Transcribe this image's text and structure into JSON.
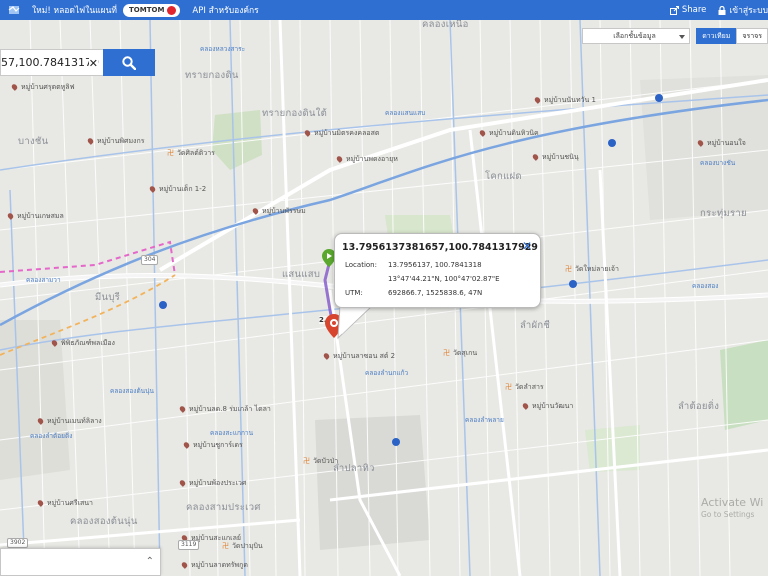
{
  "topbar": {
    "site_link": "ใหม่! หลอดไฟในแผนที่",
    "tomtom_badge": "TOMTOM",
    "api_link": "API สำหรับองค์กร",
    "share_label": "Share",
    "login_label": "เข้าสู่ระบบ"
  },
  "search": {
    "value": "57,100.78413179",
    "clear_symbol": "✕"
  },
  "layers": {
    "selected": "เลือกชั้นข้อมูล",
    "satellite_label": "ดาวเทียม",
    "traffic_label": "จราจร"
  },
  "popup": {
    "title": "13.7956137381657,100.7841317929",
    "close_symbol": "✕",
    "location_key": "Location:",
    "location_decimal": "13.7956137, 100.7841318",
    "location_dms": "13°47'44.21\"N, 100°47'02.87\"E",
    "utm_key": "UTM:",
    "utm_value": "692866.7, 1525838.6, 47N"
  },
  "route": {
    "distance_label": "2.02"
  },
  "watermark": {
    "title": "Activate Wi",
    "subtitle": "Go to Settings"
  },
  "map_labels": {
    "areas": [
      "ทรายกองดิน",
      "ทรายกองดินใต้",
      "บางชัน",
      "มีนบุรี",
      "แสนแสบ",
      "โคกแฝด",
      "ลำผักชี",
      "ลำปลาทิว",
      "คลองสามประเวศ",
      "คลองสองต้นนุ่น",
      "กระทุ่มราย",
      "ลำต้อยติ่ง",
      "คลองเหนือ"
    ],
    "pois": [
      "หมู่บ้านศรุตตหูลิฟ",
      "หมู่บ้านพิศมงกร",
      "หมู่บ้านเต็ก 1-2",
      "หมู่บ้านเกษสมล",
      "หมู่บ้านมิตรคงคลอสต",
      "หมู่บ้านพดงอายุห",
      "หมู่บ้านพัรรษม",
      "หมู่บ้านดินหิวนิค",
      "หมู่บ้านชนินุ",
      "หมู่บ้านนันทวัน 1",
      "หมู่บ้านอนใจ",
      "หมู่บ้านเมนท์ลิลาง",
      "หมู่บ้านลด.8 ร่มเกล้า ไดลา",
      "หมู่บ้านชูการ์เดร",
      "หมู่บ้านพ้องประเวศ",
      "หมู่บ้านศรีเสนา",
      "หมู่บ้านวัฒนา",
      "หมู่บ้านลาดทรัพกูด",
      "พิพิธภัณฑ์พลเมือง",
      "หมู่บ้านลาซอน สต์ 2",
      "หมู่บ้านสะแกเลย์"
    ],
    "temples": [
      "วัดศิลต์ติวาร",
      "วัดสุเกน",
      "วัดลำสาร",
      "วัดบัวป่า",
      "วัดปามุบิน",
      "วัดใหม่ลายเจ้า"
    ],
    "waters": [
      "คลองหลวงสาระ",
      "คลองแสนแสบ",
      "คลองสามวา",
      "คลองสองต้นนุ่น",
      "คลองลำพลาย",
      "คลองลำนกแก้ว",
      "คลองบางชัน",
      "คลองสะแกกาน",
      "คลองสอง",
      "คลองลำต้อยติ่ง"
    ],
    "roads": [
      "3902",
      "3119",
      "304"
    ]
  }
}
